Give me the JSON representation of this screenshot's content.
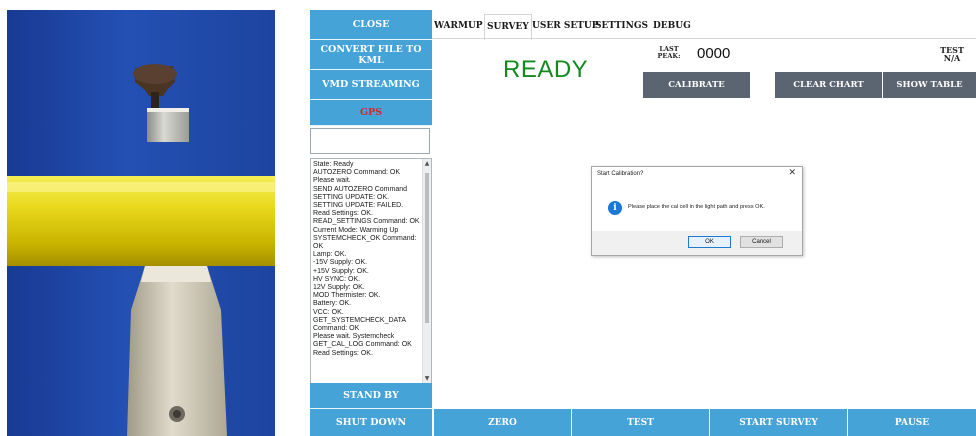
{
  "sidebar": {
    "close": "CLOSE",
    "convert": "CONVERT FILE TO KML",
    "vmd": "VMD STREAMING",
    "gps": "GPS",
    "gps_value": "",
    "log": "State: Ready\nAUTOZERO Command: OK\nPlease wait.\nSEND AUTOZERO Command\nSETTING UPDATE: OK.\nSETTING UPDATE: FAILED.\nRead Settings: OK.\nREAD_SETTINGS Command: OK\nCurrent Mode: Warming Up\nSYSTEMCHECK_OK Command: OK\nLamp: OK.\n-15V Supply: OK.\n+15V Supply: OK.\nHV SYNC: OK.\n12V Supply: OK.\nMOD Thermister: OK.\nBattery: OK.\nVCC: OK.\nGET_SYSTEMCHECK_DATA Command: OK\nPlease wait. Systemcheck\nGET_CAL_LOG Command: OK\nRead Settings: OK.",
    "standby": "STAND BY",
    "shutdown": "SHUT DOWN"
  },
  "tabs": [
    "WARMUP",
    "SURVEY",
    "USER SETUP",
    "SETTINGS",
    "DEBUG"
  ],
  "active_tab": "SURVEY",
  "main": {
    "status": "READY",
    "last_peak_label": "LAST PEAK:",
    "last_peak_value": "0000",
    "test_label": "TEST",
    "test_value": "N/A",
    "calibrate": "CALIBRATE",
    "clear_chart": "CLEAR CHART",
    "show_table": "SHOW TABLE"
  },
  "dialog": {
    "title": "Start Calibration?",
    "message": "Please place the cal cell in the light path and press OK.",
    "ok": "OK",
    "cancel": "Cancel"
  },
  "bottom": {
    "zero": "ZERO",
    "test": "TEST",
    "start_survey": "START SURVEY",
    "pause": "PAUSE"
  },
  "colors": {
    "button_blue": "#45a3d8",
    "action_gray": "#5b6471",
    "ready_green": "#138a1e",
    "gps_red": "#d8262a"
  }
}
